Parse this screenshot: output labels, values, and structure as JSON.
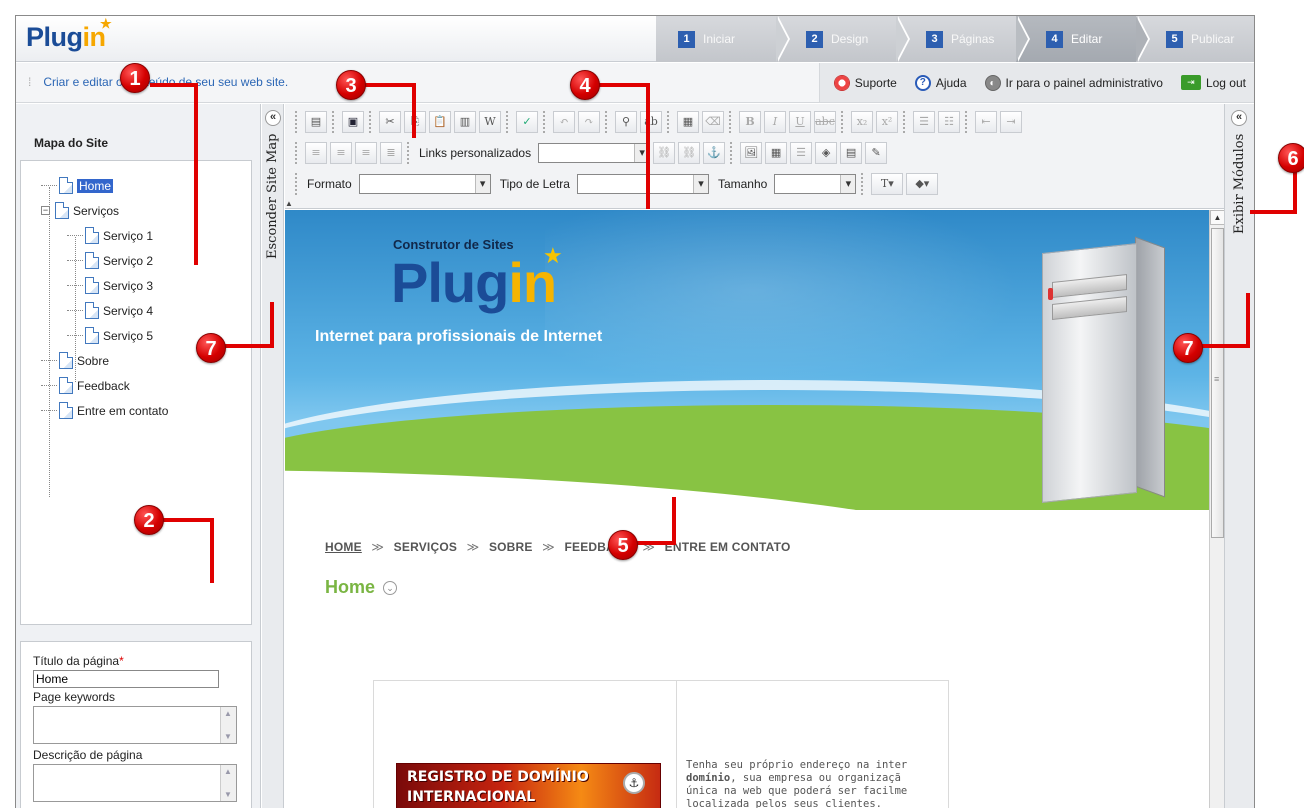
{
  "app": {
    "logo_main": "Plug",
    "logo_accent": "in"
  },
  "steps": [
    {
      "num": "1",
      "label": "Iniciar"
    },
    {
      "num": "2",
      "label": "Design"
    },
    {
      "num": "3",
      "label": "Páginas"
    },
    {
      "num": "4",
      "label": "Editar",
      "active": true
    },
    {
      "num": "5",
      "label": "Publicar"
    }
  ],
  "subbar": {
    "hint": "Criar e editar o conteúdo de seu seu web site.",
    "links": {
      "support": "Suporte",
      "help": "Ajuda",
      "admin": "Ir para o painel administrativo",
      "logout": "Log out"
    }
  },
  "sitemap": {
    "title": "Mapa do Site",
    "items": {
      "home": "Home",
      "servicos": "Serviços",
      "servico1": "Serviço 1",
      "servico2": "Serviço 2",
      "servico3": "Serviço 3",
      "servico4": "Serviço 4",
      "servico5": "Serviço 5",
      "sobre": "Sobre",
      "feedback": "Feedback",
      "contato": "Entre em contato"
    },
    "hide_label": "Esconder Site Map"
  },
  "form": {
    "title_label": "Título da página",
    "title_required": "*",
    "title_value": "Home",
    "keywords_label": "Page keywords",
    "description_label": "Descrição de página"
  },
  "right_panel": {
    "label": "Exibir Módulos"
  },
  "toolbar": {
    "links_label": "Links personalizados",
    "format_label": "Formato",
    "font_label": "Tipo de Letra",
    "size_label": "Tamanho"
  },
  "content": {
    "banner_sub": "Construtor de Sites",
    "banner_logo_main": "Plug",
    "banner_logo_accent": "in",
    "banner_tagline": "Internet para profissionais de Internet",
    "nav": [
      "HOME",
      "SERVIÇOS",
      "SOBRE",
      "FEEDBACK",
      "ENTRE EM CONTATO"
    ],
    "nav_sep": "≫",
    "page_heading": "Home",
    "domain_line1": "REGISTRO DE DOMÍNIO",
    "domain_line2": "INTERNACIONAL",
    "desc_line1": "Tenha seu próprio endereço na inter",
    "desc_line2_bold": "domínio",
    "desc_line2_rest": ", sua empresa ou organizaçã",
    "desc_line3": "única na web que poderá ser facilme",
    "desc_line4": "localizada pelos seus clientes."
  },
  "annotations": [
    "1",
    "2",
    "3",
    "4",
    "5",
    "6",
    "7",
    "7"
  ],
  "colors": {
    "brand_blue": "#1b4c97",
    "brand_orange": "#f6a700",
    "annotation_red": "#d40000",
    "heading_green": "#7ab543"
  }
}
